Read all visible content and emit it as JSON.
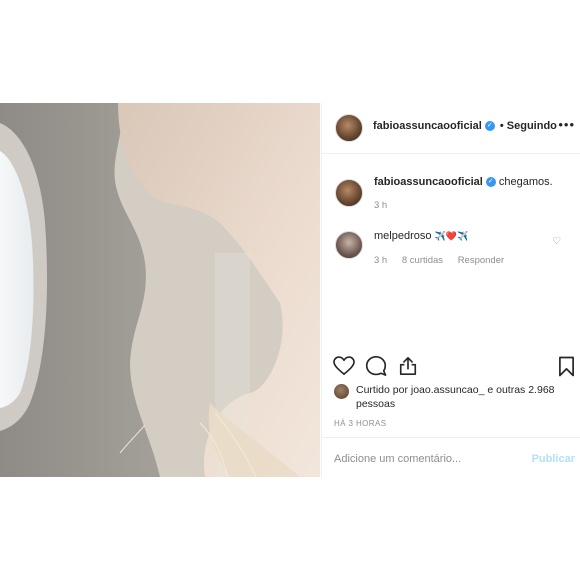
{
  "post": {
    "author": {
      "username": "fabioassuncaooficial",
      "verified": true,
      "follow_status": "• Seguindo"
    },
    "more_icon": "more-horizontal-icon",
    "caption": {
      "username": "fabioassuncaooficial",
      "text": "chegamos.",
      "time": "3 h"
    },
    "comments": [
      {
        "username": "melpedroso",
        "text": "✈️❤️✈️",
        "time": "3 h",
        "likes": "8 curtidas",
        "reply_label": "Responder"
      }
    ],
    "actions": {
      "like_icon": "heart-icon",
      "comment_icon": "comment-bubble-icon",
      "share_icon": "share-icon",
      "save_icon": "bookmark-icon"
    },
    "liked_by": {
      "prefix": "Curtido por",
      "user": "joao.assuncao_",
      "rest": "e outras 2.968 pessoas"
    },
    "posted_ago": "HÁ 3 HORAS",
    "add_comment": {
      "placeholder": "Adicione um comentário...",
      "publish_label": "Publicar"
    }
  },
  "colors": {
    "accent": "#3897f0",
    "publish_disabled": "#b2dffc",
    "muted": "#8e8e8e"
  }
}
